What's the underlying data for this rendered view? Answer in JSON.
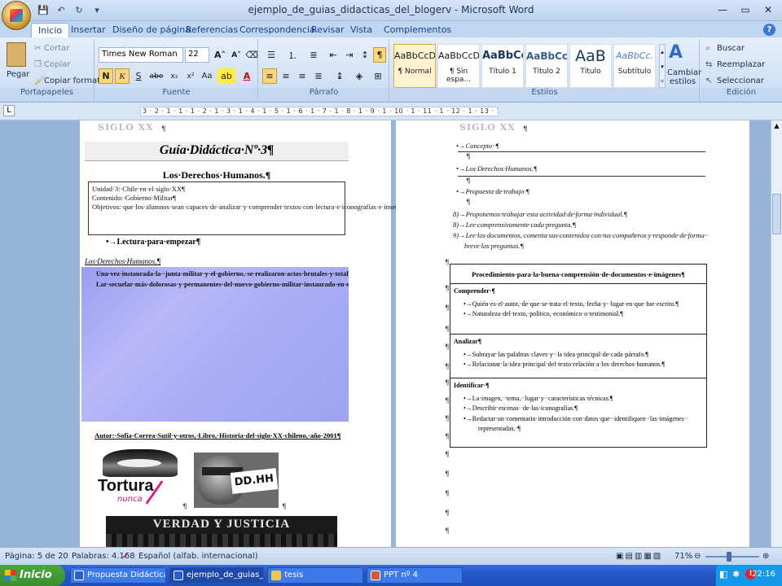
{
  "window": {
    "title": "ejemplo_de_guias_didacticas_del_blogerv - Microsoft Word"
  },
  "qat": {
    "save": "💾",
    "undo": "↶",
    "redo": "↻"
  },
  "winbtns": {
    "minimize": "—",
    "maximize": "▭",
    "close": "✕"
  },
  "tabs": [
    "Inicio",
    "Insertar",
    "Diseño de página",
    "Referencias",
    "Correspondencia",
    "Revisar",
    "Vista",
    "Complementos"
  ],
  "ribbon": {
    "portapapeles": {
      "paste": "Pegar",
      "cut": "Cortar",
      "copy": "Copiar",
      "format": "Copiar formato",
      "label": "Portapapeles"
    },
    "fuente": {
      "font": "Times New Roman",
      "size": "22",
      "label": "Fuente"
    },
    "parrafo": {
      "label": "Párrafo"
    },
    "estilos": {
      "label": "Estilos",
      "items": [
        {
          "sample": "AaBbCcDc",
          "name": "¶ Normal"
        },
        {
          "sample": "AaBbCcDc",
          "name": "¶ Sin espa..."
        },
        {
          "sample": "AaBbCc",
          "name": "Título 1"
        },
        {
          "sample": "AaBbCc",
          "name": "Título 2"
        },
        {
          "sample": "AaB",
          "name": "Título"
        },
        {
          "sample": "AaBbCc.",
          "name": "Subtítulo"
        }
      ],
      "change": "Cambiar estilos"
    },
    "edicion": {
      "find": "Buscar",
      "replace": "Reemplazar",
      "select": "Seleccionar",
      "label": "Edición"
    }
  },
  "ruler": {
    "marks": "3 · 2 · 1 · 1 · 1 · 2 · 1 · 3 · 1 · 4 · 1 · 5 · 1 · 6 · 1 · 7 · 1 · 8 · 1 · 9 · 1 · 10 · 1 · 11 · 1 · 12 · 1 · 13 · 1 · 14 · 1 · 15 · 1 · 17 · 18"
  },
  "left_page": {
    "header_logo": "SIGLO XX",
    "title": "Guía·Didáctica·Nº·3¶",
    "subtitle": "Los·Derechos·Humanos.¶",
    "info": [
      "Unidad·3:·Chile·en·el·siglo·XX¶",
      "Contenido:·Gobierno·Militar¶",
      "Objetivos:·que·los·alumnos·sean·capaces·de·analizar·y·comprender·textos·con·lectura·e·iconografías·e·insertarlos·en·un·contexto·determinado,·de·acuerdo·a·los·mapas·de·progreso·establecidos·por·el·Mineduc.¶"
    ],
    "read_label": "•→Lectura·para·empezar¶",
    "dh_label": "Los·Derechos·Humanos.¶",
    "reading": [
      "Una·vez·instaurada·la··junta·militar·y·el·gobierno,·se·realizaron·actos·brutales·y·totalitarios,·un·estado·militar·como·nunca·antes·se·había·instaurado·en·el·poder,·una·fuerza·militar·con·un·orden·político·por·consolidar.·Se·trató·de·un·vuelco·tremendo·en·la·institucionalidad·vigente·en·el·país·y·en·la·ciudad,·a·pesar·de·la·intención·de·restaurar·al·país·de·la·crisis·vivida·durante·el·gobierno·de·la·Unidad·Popular,·las·acciones·de·refundación,·reconstrucción·y·restauración·del·país·se·tornaron·radicales,·el·poder·instaurado·por·el·gobierno·militar·no·ha·habido·jamás·en·la·historia·de·la·nación.·Para·la·organización·de·derechos·humanos,·el·principal·instrumento·de·represión·fue·la·DINA,·bajo·el·mando·del·Coronel·de·Manuel·Contreras·Sepúlveda.·Este·instrumento·fue·creado·por·el·decreto·→·ley·secreto·en·julio·de·1974,·componiéndose·de·varios·departamentos·como:·inteligencia,·gobierno,·guerra·sicológica,·economía·y·sociedad.¶",
      "Lar·secuelar·más·dolorosas·y·permanentes·del·nuevo·gobierno·militar·instaurado·en·el·país,·fue·que·las·autoridades·castrenses,·negaron·sistemáticamente·la·violación·de·los·derechos·humanos.¶"
    ],
    "author": "Autor:·Sofía·Correa·Sutil·y·otros,·Libro,·Historia·del·siglo·XX·chileno,·año·2001¶",
    "img1_text": "Tortura",
    "img1_sub": "nunca",
    "img2_text": "DD.HH",
    "img3_text": "VERDAD Y JUSTICIA"
  },
  "right_page": {
    "header_logo": "SIGLO XX",
    "bullets": [
      "•→Concepto··¶",
      "•→Los·Derechos·Humanos.¶",
      "•→Propuesta·de·trabajo·¶"
    ],
    "numbered": [
      "8)→Proponemos·trabajar·esta·actividad·de·forma·individual.¶",
      "8)→Lee·comprensivamente·cada·pregunta.¶",
      "9)→Lee·los·documentos,·comenta·sus·contenidos·con·tus·compañeros·y·responde·de·forma··",
      "breve·las·preguntas.¶"
    ],
    "table_title": "Procedimiento·para·la·buena·comprensión·de·documentos·e·imágenes¶",
    "sections": [
      {
        "head": "Comprender·¶",
        "items": [
          "•→Quién·es·el·autor,·de·que·se·trata·el·texto,·fecha·y··lugar·en·que·fue·escrito.¶",
          "•→Naturaleza·del·texto,·político,·económico·o·testimonial.¶"
        ]
      },
      {
        "head": "Analizar¶",
        "items": [
          "•→Subrayar·las·palabras·claves·y··la·idea·principal·de·cada·párrafo.¶",
          "•→Relacionar·la·idea·principal·del·texto·relación·a·los·derechos·humanos.¶"
        ]
      },
      {
        "head": "Identificar·¶",
        "items": [
          "•→La·imagen,··tema,··lugar·y··características·técnicas.¶",
          "•→Describir·escenas··de·las·iconografías.¶",
          "•→Redactar·un·comentario·introducción·con·datos·que··identifiquen··las·imágenes··",
          "representadas.·¶"
        ]
      }
    ]
  },
  "status": {
    "page": "Página: 5 de 20",
    "words": "Palabras: 4.168",
    "lang": "Español (alfab. internacional)",
    "zoom": "71%"
  },
  "taskbar": {
    "start": "Inicio",
    "tasks": [
      "Propuesta Didáctica T...",
      "ejemplo_de_guias_di...",
      "tesis",
      "PPT nº 4"
    ],
    "clock": "22:16"
  }
}
